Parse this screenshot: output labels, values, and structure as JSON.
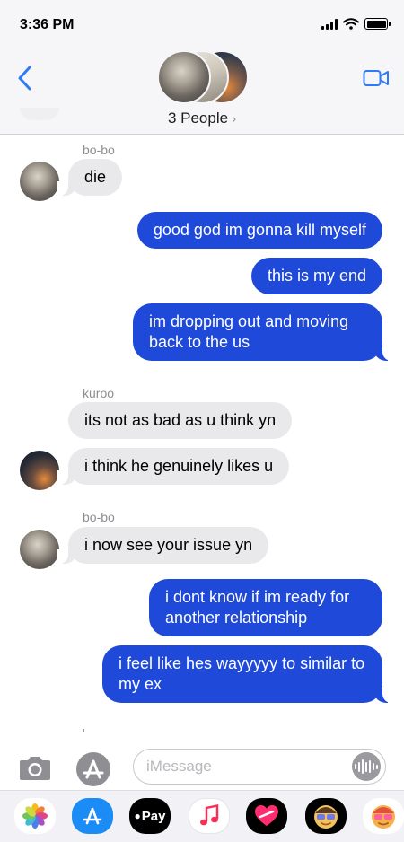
{
  "status_bar": {
    "time": "3:36 PM"
  },
  "header": {
    "people_label": "3 People",
    "chevron": "›"
  },
  "messages": [
    {
      "sender": "bo-bo",
      "side": "in",
      "text": "die"
    },
    {
      "side": "out",
      "text": "good god im gonna kill myself"
    },
    {
      "side": "out",
      "text": "this is my end"
    },
    {
      "side": "out",
      "text": "im dropping out and moving back to the us"
    },
    {
      "sender": "kuroo",
      "side": "in",
      "text": "its not as bad as u think yn"
    },
    {
      "side": "in",
      "text": "i think he genuinely likes u"
    },
    {
      "sender": "bo-bo",
      "side": "in",
      "text": "i now see your issue yn"
    },
    {
      "side": "out",
      "text": "i dont know if im ready for another relationship"
    },
    {
      "side": "out",
      "text": "i feel like hes wayyyyy to similar to my ex"
    }
  ],
  "input": {
    "placeholder": "iMessage"
  },
  "app_drawer": {
    "items": [
      {
        "name": "photos-app-icon"
      },
      {
        "name": "app-store-icon"
      },
      {
        "name": "apple-pay-icon",
        "label": "Pay"
      },
      {
        "name": "music-app-icon"
      },
      {
        "name": "digital-touch-icon"
      },
      {
        "name": "memoji-icon"
      },
      {
        "name": "memoji-stickers-icon"
      }
    ]
  },
  "colors": {
    "outgoing_bubble": "#1f49d8",
    "incoming_bubble": "#e9e9eb",
    "accent": "#2f7bf6"
  }
}
